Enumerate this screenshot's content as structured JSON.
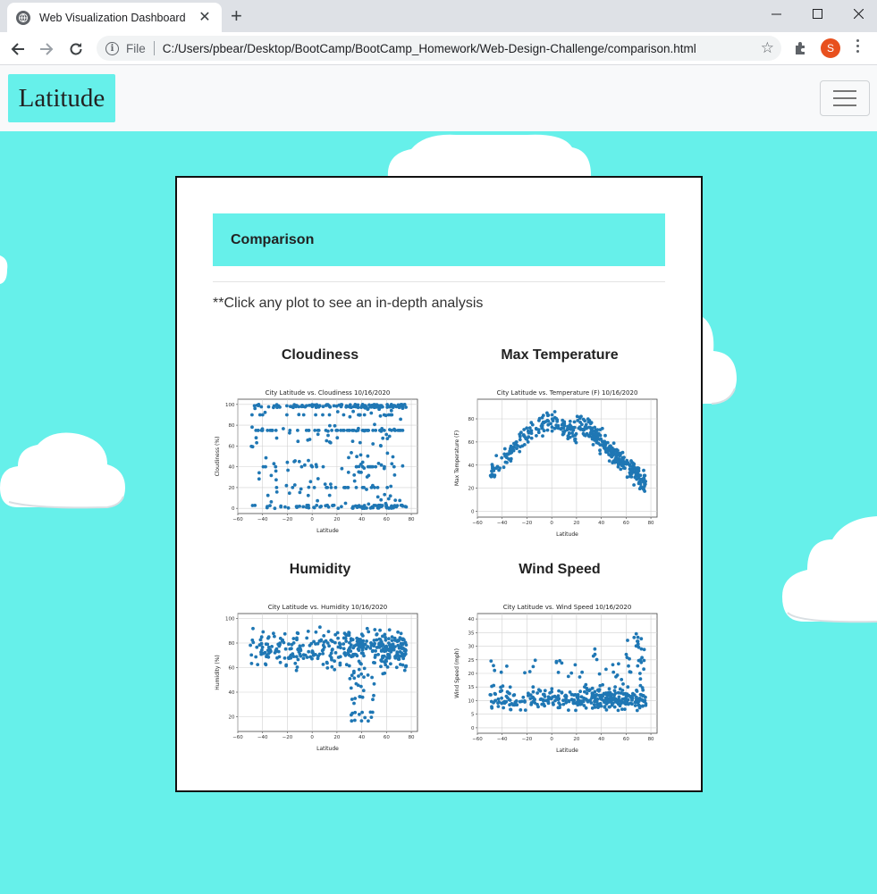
{
  "browser": {
    "tab_title": "Web Visualization Dashboard",
    "file_label": "File",
    "url": "C:/Users/pbear/Desktop/BootCamp/BootCamp_Homework/Web-Design-Challenge/comparison.html",
    "avatar_letter": "S"
  },
  "navbar": {
    "brand": "Latitude"
  },
  "page": {
    "heading": "Comparison",
    "note": "**Click any plot to see an in-depth analysis"
  },
  "plots": [
    {
      "label": "Cloudiness",
      "chart_data": {
        "type": "scatter",
        "title": "City Latitude vs. Cloudiness 10/16/2020",
        "xlabel": "Latitude",
        "ylabel": "Cloudiness (%)",
        "xlim": [
          -60,
          85
        ],
        "ylim": [
          -5,
          105
        ],
        "xticks": [
          -60,
          -40,
          -20,
          0,
          20,
          40,
          60,
          80
        ],
        "yticks": [
          0,
          20,
          40,
          60,
          80,
          100
        ],
        "grid": true,
        "color": "#1f77b4"
      }
    },
    {
      "label": "Max Temperature",
      "chart_data": {
        "type": "scatter",
        "title": "City Latitude vs. Temperature (F) 10/16/2020",
        "xlabel": "Latitude",
        "ylabel": "Max Temperature (F)",
        "xlim": [
          -60,
          85
        ],
        "ylim": [
          -5,
          97
        ],
        "xticks": [
          -60,
          -40,
          -20,
          0,
          20,
          40,
          60,
          80
        ],
        "yticks": [
          0,
          20,
          40,
          60,
          80
        ],
        "grid": true,
        "color": "#1f77b4"
      }
    },
    {
      "label": "Humidity",
      "chart_data": {
        "type": "scatter",
        "title": "City Latitude vs. Humidity 10/16/2020",
        "xlabel": "Latitude",
        "ylabel": "Humidity (%)",
        "xlim": [
          -60,
          85
        ],
        "ylim": [
          8,
          104
        ],
        "xticks": [
          -60,
          -40,
          -20,
          0,
          20,
          40,
          60,
          80
        ],
        "yticks": [
          20,
          40,
          60,
          80,
          100
        ],
        "grid": true,
        "color": "#1f77b4"
      }
    },
    {
      "label": "Wind Speed",
      "chart_data": {
        "type": "scatter",
        "title": "City Latitude vs. Wind Speed 10/16/2020",
        "xlabel": "Latitude",
        "ylabel": "Wind Speed (mph)",
        "xlim": [
          -60,
          85
        ],
        "ylim": [
          -2,
          42
        ],
        "xticks": [
          -60,
          -40,
          -20,
          0,
          20,
          40,
          60,
          80
        ],
        "yticks": [
          0,
          5,
          10,
          15,
          20,
          25,
          30,
          35,
          40
        ],
        "grid": true,
        "color": "#1f77b4"
      }
    }
  ]
}
